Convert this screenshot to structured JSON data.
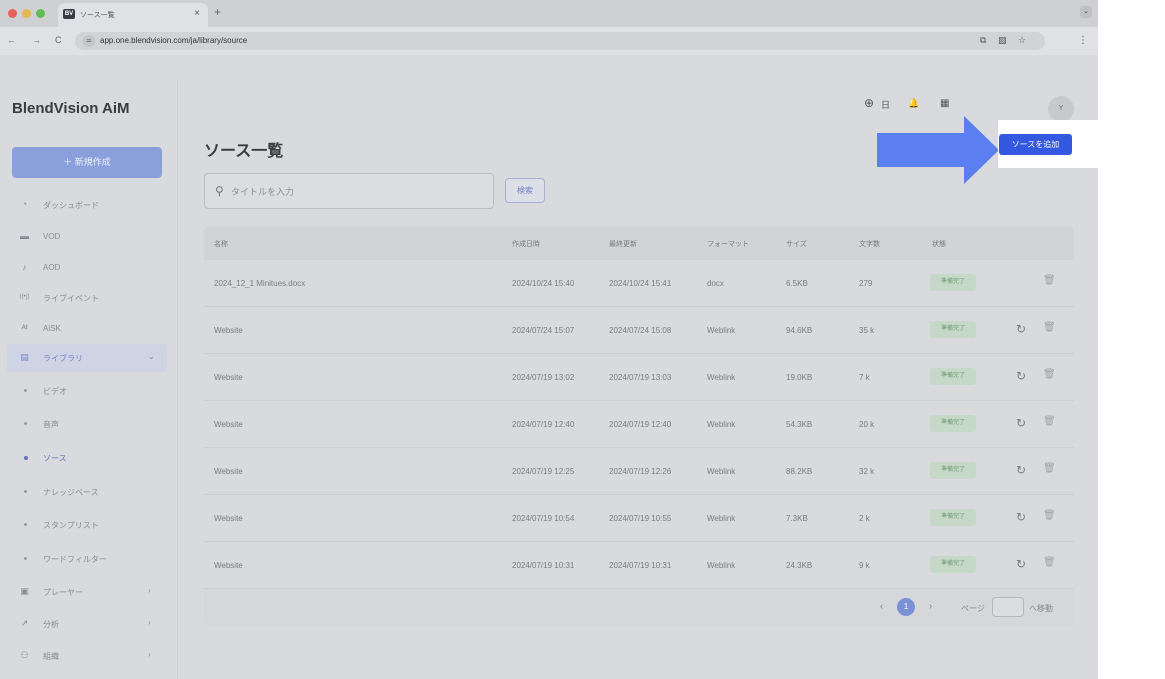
{
  "browser": {
    "tab_title": "ソース一覧",
    "tab_favicon": "BV",
    "url": "app.one.blendvision.com/ja/library/source",
    "traffic_colors": [
      "#e5625a",
      "#e4b94a",
      "#5fbf54"
    ]
  },
  "sidebar": {
    "brand": "BlendVision AiM",
    "new_button": "＋ 新規作成",
    "items": [
      {
        "label": "ダッシュボード",
        "icon": "◔"
      },
      {
        "label": "VOD",
        "icon": "▬"
      },
      {
        "label": "AOD",
        "icon": "♪"
      },
      {
        "label": "ライブイベント",
        "icon": "((•))"
      },
      {
        "label": "AiSK",
        "icon": "AI"
      },
      {
        "label": "ライブラリ",
        "icon": "▤",
        "chevron": "⌄"
      },
      {
        "label": "ビデオ"
      },
      {
        "label": "音声"
      },
      {
        "label": "ソース"
      },
      {
        "label": "ナレッジベース"
      },
      {
        "label": "スタンプリスト"
      },
      {
        "label": "ワードフィルター"
      },
      {
        "label": "プレーヤー",
        "icon": "▣",
        "chevron": "›"
      },
      {
        "label": "分析",
        "icon": "↗",
        "chevron": "›"
      },
      {
        "label": "組織",
        "icon": "⚇",
        "chevron": "›"
      }
    ]
  },
  "header": {
    "lang_icon": "⊕",
    "lang_label": "日",
    "bell_icon": "🔔",
    "org_icon": "▦",
    "avatar": "Y"
  },
  "main": {
    "title": "ソース一覧",
    "search_placeholder": "タイトルを入力",
    "search_button": "検索",
    "add_button": "ソースを追加"
  },
  "table": {
    "columns": [
      "名称",
      "作成日時",
      "最終更新",
      "フォーマット",
      "サイズ",
      "文字数",
      "状態"
    ],
    "rows": [
      {
        "name": "2024_12_1 Minitues.docx",
        "created": "2024/10/24 15:40",
        "updated": "2024/10/24 15:41",
        "format": "docx",
        "size": "6.5KB",
        "chars": "279",
        "status": "準備完了",
        "refresh": false
      },
      {
        "name": "Website",
        "created": "2024/07/24 15:07",
        "updated": "2024/07/24 15:08",
        "format": "Weblink",
        "size": "94.6KB",
        "chars": "35 k",
        "status": "準備完了",
        "refresh": true
      },
      {
        "name": "Website",
        "created": "2024/07/19 13:02",
        "updated": "2024/07/19 13:03",
        "format": "Weblink",
        "size": "19.0KB",
        "chars": "7 k",
        "status": "準備完了",
        "refresh": true
      },
      {
        "name": "Website",
        "created": "2024/07/19 12:40",
        "updated": "2024/07/19 12:40",
        "format": "Weblink",
        "size": "54.3KB",
        "chars": "20 k",
        "status": "準備完了",
        "refresh": true
      },
      {
        "name": "Website",
        "created": "2024/07/19 12:25",
        "updated": "2024/07/19 12:26",
        "format": "Weblink",
        "size": "88.2KB",
        "chars": "32 k",
        "status": "準備完了",
        "refresh": true
      },
      {
        "name": "Website",
        "created": "2024/07/19 10:54",
        "updated": "2024/07/19 10:55",
        "format": "Weblink",
        "size": "7.3KB",
        "chars": "2 k",
        "status": "準備完了",
        "refresh": true
      },
      {
        "name": "Website",
        "created": "2024/07/19 10:31",
        "updated": "2024/07/19 10:31",
        "format": "Weblink",
        "size": "24.3KB",
        "chars": "9 k",
        "status": "準備完了",
        "refresh": true
      }
    ]
  },
  "pagination": {
    "prev": "‹",
    "current": "1",
    "next": "›",
    "page_label": "ページ",
    "goto_label": "へ移動"
  },
  "colors": {
    "arrow": "#5b7ff0",
    "add_button": "#3558e0"
  }
}
